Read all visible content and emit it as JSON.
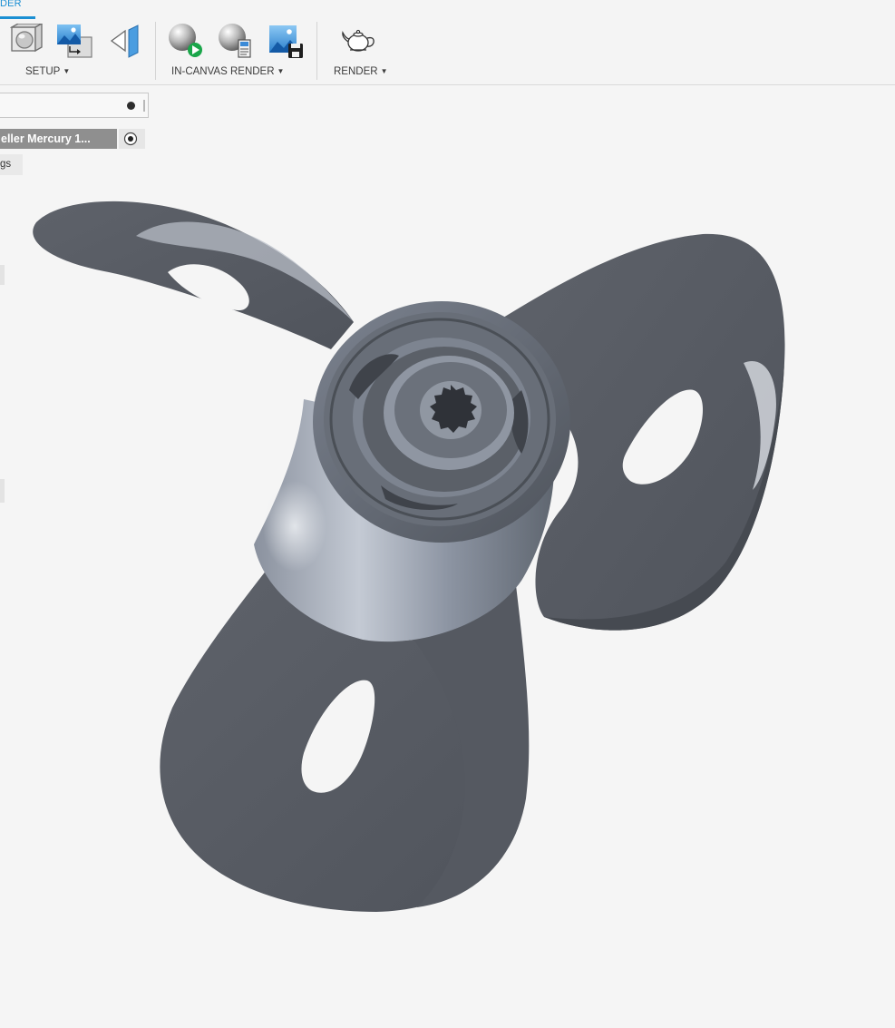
{
  "ribbon": {
    "active_tab": "DER",
    "groups": [
      {
        "label": "SETUP",
        "dropdown": true
      },
      {
        "label": "IN-CANVAS RENDER",
        "dropdown": true
      },
      {
        "label": "RENDER",
        "dropdown": true
      }
    ],
    "caret": "▼"
  },
  "browser": {
    "search_placeholder": "",
    "document_name": "eller Mercury 1...",
    "settings_label": "gs"
  },
  "colors": {
    "accent": "#1b8fd3",
    "model_surface": "#5a5e66",
    "hub_highlight": "#9aa2b0",
    "canvas_background": "#f5f5f5"
  },
  "icons": [
    "scene-settings-icon",
    "environment-library-icon",
    "texture-map-icon",
    "in-canvas-render-start-icon",
    "in-canvas-render-settings-icon",
    "capture-image-icon",
    "render-teapot-icon"
  ]
}
